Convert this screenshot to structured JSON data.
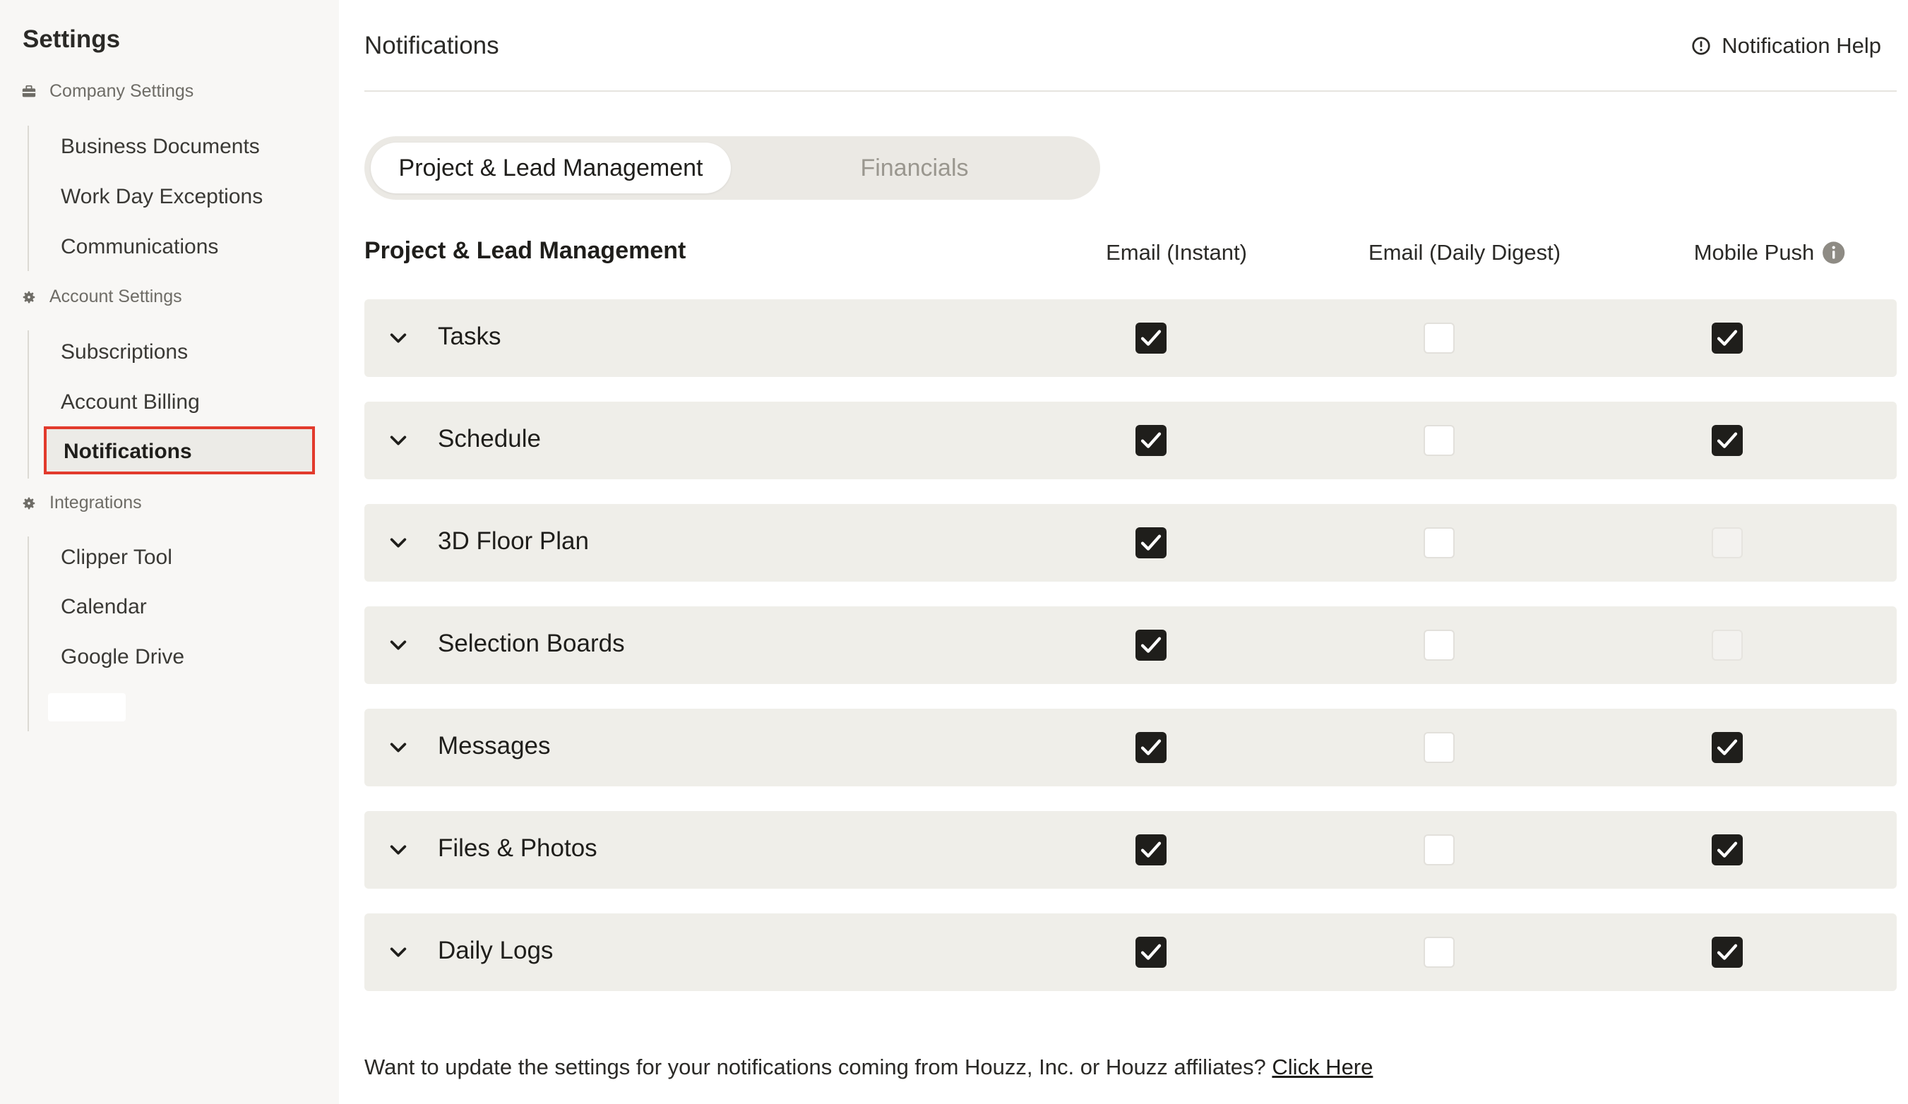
{
  "sidebar": {
    "title": "Settings",
    "groups": [
      {
        "label": "Company Settings",
        "items": [
          "Business Documents",
          "Work Day Exceptions",
          "Communications"
        ]
      },
      {
        "label": "Account Settings",
        "items": [
          "Subscriptions",
          "Account Billing",
          "Notifications"
        ]
      },
      {
        "label": "Integrations",
        "items": [
          "Clipper Tool",
          "Calendar",
          "Google Drive"
        ]
      }
    ],
    "active_item": "Notifications"
  },
  "header": {
    "title": "Notifications",
    "help_label": "Notification Help"
  },
  "tabs": [
    {
      "label": "Project & Lead Management",
      "active": true
    },
    {
      "label": "Financials",
      "active": false
    }
  ],
  "table": {
    "section_title": "Project & Lead Management",
    "columns": [
      "Email (Instant)",
      "Email (Daily Digest)",
      "Mobile Push"
    ],
    "rows": [
      {
        "label": "Tasks",
        "email_instant": "checked",
        "email_digest": "unchecked",
        "mobile_push": "checked"
      },
      {
        "label": "Schedule",
        "email_instant": "checked",
        "email_digest": "unchecked",
        "mobile_push": "checked"
      },
      {
        "label": "3D Floor Plan",
        "email_instant": "checked",
        "email_digest": "unchecked",
        "mobile_push": "disabled"
      },
      {
        "label": "Selection Boards",
        "email_instant": "checked",
        "email_digest": "unchecked",
        "mobile_push": "disabled"
      },
      {
        "label": "Messages",
        "email_instant": "checked",
        "email_digest": "unchecked",
        "mobile_push": "checked"
      },
      {
        "label": "Files & Photos",
        "email_instant": "checked",
        "email_digest": "unchecked",
        "mobile_push": "checked"
      },
      {
        "label": "Daily Logs",
        "email_instant": "checked",
        "email_digest": "unchecked",
        "mobile_push": "checked"
      }
    ]
  },
  "footer": {
    "text": "Want to update the settings for your notifications coming from Houzz, Inc. or Houzz affiliates? ",
    "link": "Click Here"
  },
  "colors": {
    "sidebar_bg": "#f8f7f5",
    "row_bg": "#efeee9",
    "highlight_border": "#e23a2c",
    "checkbox_checked": "#1f1e1b"
  },
  "icons": {
    "company": "briefcase-icon",
    "account": "gear-icon",
    "integrations": "gear-icon",
    "help": "info-circle-icon",
    "mobile_push_info": "info-icon",
    "row_toggle": "chevron-down-icon"
  }
}
